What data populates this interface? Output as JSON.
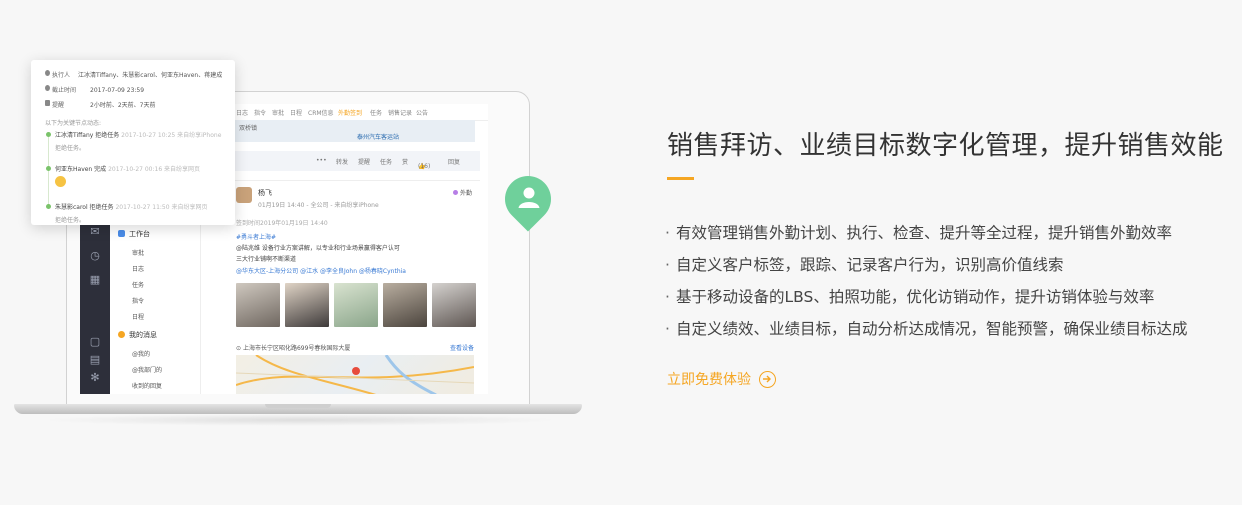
{
  "headline": "销售拜访、业绩目标数字化管理，提升销售效能",
  "features": [
    "有效管理销售外勤计划、执行、检查、提升等全过程，提升销售外勤效率",
    "自定义客户标签，跟踪、记录客户行为，识别高价值线索",
    "基于移动设备的LBS、拍照功能，优化访销动作，提升访销体验与效率",
    "自定义绩效、业绩目标，自动分析达成情况，智能预警，确保业绩目标达成"
  ],
  "bullet": "·",
  "cta": {
    "label": "立即免费体验",
    "icon": "arrow-right-circle-icon"
  },
  "colors": {
    "accent": "#f5a623",
    "pin": "#6fd09b",
    "sidebar": "#2d2f3a",
    "link": "#3b7bd4"
  },
  "popup": {
    "rows": [
      {
        "key": "执行人",
        "value": "江冰清Tiffany、朱慧影carol、何亚东Haven、蒋建成",
        "icon": "user-icon"
      },
      {
        "key": "截止时间",
        "value": "2017-07-09 23:59",
        "icon": "clock-icon"
      },
      {
        "key": "提醒",
        "value": "2小时前、2天前、7天前",
        "icon": "bell-icon"
      }
    ],
    "note": "以下为关键节点动态:",
    "timeline": [
      {
        "text": "江冰清Tiffany 拒绝任务",
        "meta": "2017-10-27 10:25 来自纷享iPhone",
        "sub": "拒绝任务。"
      },
      {
        "text": "何亚东Haven 完成",
        "meta": "2017-10-27 00:16 来自纷享网页",
        "sub": ""
      },
      {
        "text": "朱慧影carol 拒绝任务",
        "meta": "2017-10-27 11:50 来自纷享网页",
        "sub": "拒绝任务。"
      }
    ]
  },
  "app": {
    "tabs": [
      "日志",
      "指令",
      "审批",
      "日程",
      "CRM信息",
      "外勤签到",
      "任务",
      "销售记录",
      "公告"
    ],
    "active_tab": "外勤签到",
    "map_strip_label": "双桥镇",
    "map_strip_place": "泰州汽车客运站",
    "actions": [
      "转发",
      "提醒",
      "任务",
      "赏",
      "(16)",
      "回复"
    ],
    "nav": {
      "group1": "工作台",
      "group1_items": [
        "审批",
        "日志",
        "任务",
        "指令",
        "日程"
      ],
      "group2": "我的消息",
      "group2_items": [
        "@我的",
        "@我部门的",
        "收到的回复"
      ]
    },
    "post": {
      "name": "杨飞",
      "meta": "01月19日 14:40 - 全公司 - 来自纷享iPhone",
      "tag": "外勤",
      "checkin": "签到时间2019年01月19日 14:40",
      "topic": "#勇斗者上海#",
      "body1": "@陆兆维 设备行业方案讲解，以专业和行业场景赢得客户认可",
      "body2": "三大行业铺啊不断渠道",
      "mentions": "@华东大区-上海分公司 @江水 @李全良John @杨春晓Cynthia",
      "address": "上海市长宁区昭化路699号春秋国际大厦",
      "view_device": "查看设备"
    }
  }
}
